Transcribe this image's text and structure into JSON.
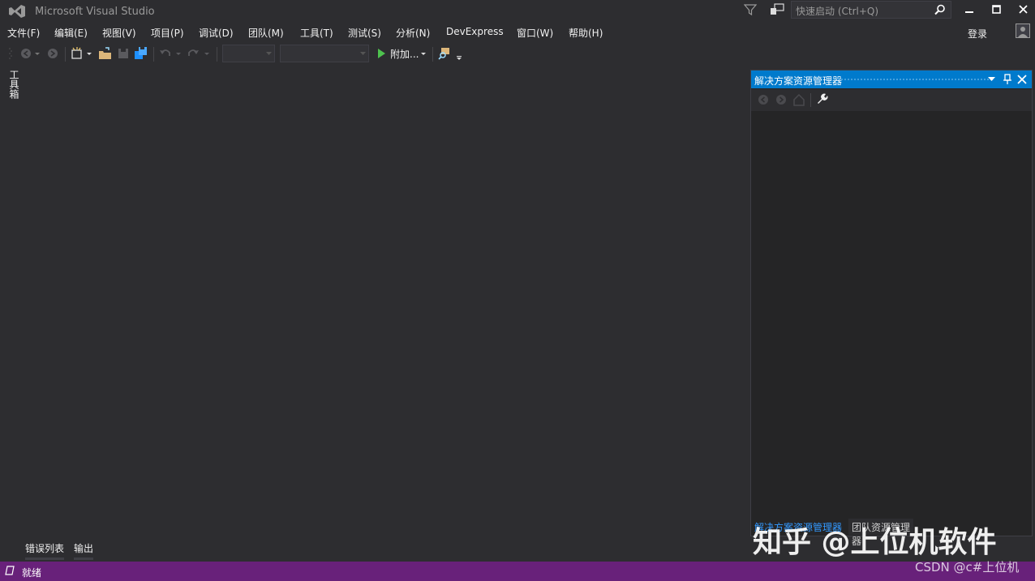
{
  "window": {
    "title": "Microsoft Visual Studio",
    "quick_launch_placeholder": "快速启动 (Ctrl+Q)",
    "sign_in": "登录"
  },
  "menu": [
    "文件(F)",
    "编辑(E)",
    "视图(V)",
    "项目(P)",
    "调试(D)",
    "团队(M)",
    "工具(T)",
    "测试(S)",
    "分析(N)",
    "DevExpress",
    "窗口(W)",
    "帮助(H)"
  ],
  "toolbar": {
    "attach_label": "附加..."
  },
  "left_rail": {
    "toolbox_label": "工具箱"
  },
  "solution_explorer": {
    "title": "解决方案资源管理器",
    "tabs": [
      "解决方案资源管理器",
      "团队资源管理器"
    ]
  },
  "bottom_tabs": [
    "错误列表",
    "输出"
  ],
  "status": {
    "text": "就绪"
  },
  "watermarks": {
    "zhihu": "知乎 @上位机软件",
    "csdn": "CSDN @c#上位机"
  },
  "colors": {
    "background": "#2d2d30",
    "accent": "#007acc",
    "status_bar": "#68217a"
  }
}
